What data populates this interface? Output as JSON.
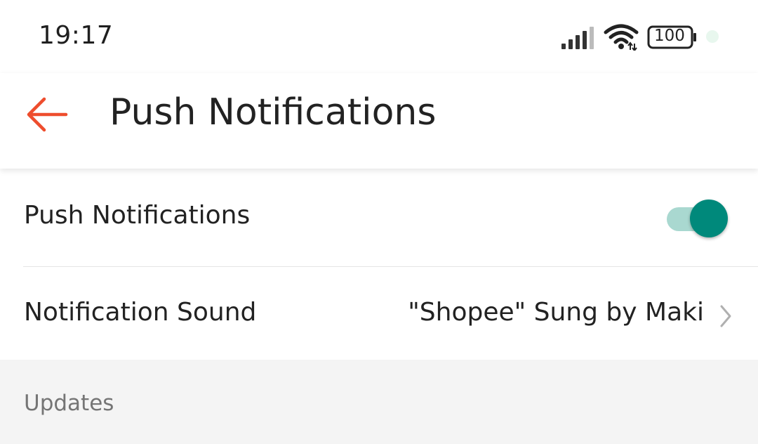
{
  "status_bar": {
    "time": "19:17",
    "battery": "100",
    "icons": [
      "signal-icon",
      "wifi-icon",
      "battery-icon"
    ]
  },
  "header": {
    "title": "Push Notifications",
    "back_icon": "back-arrow-icon",
    "accent_color": "#ee4d2d"
  },
  "settings": {
    "push_notifications": {
      "label": "Push Notifications",
      "enabled": true,
      "toggle_color": "#00897b"
    },
    "notification_sound": {
      "label": "Notification Sound",
      "value": "\"Shopee\" Sung by Maki",
      "icon": "chevron-right-icon"
    }
  },
  "sections": {
    "updates": "Updates"
  }
}
